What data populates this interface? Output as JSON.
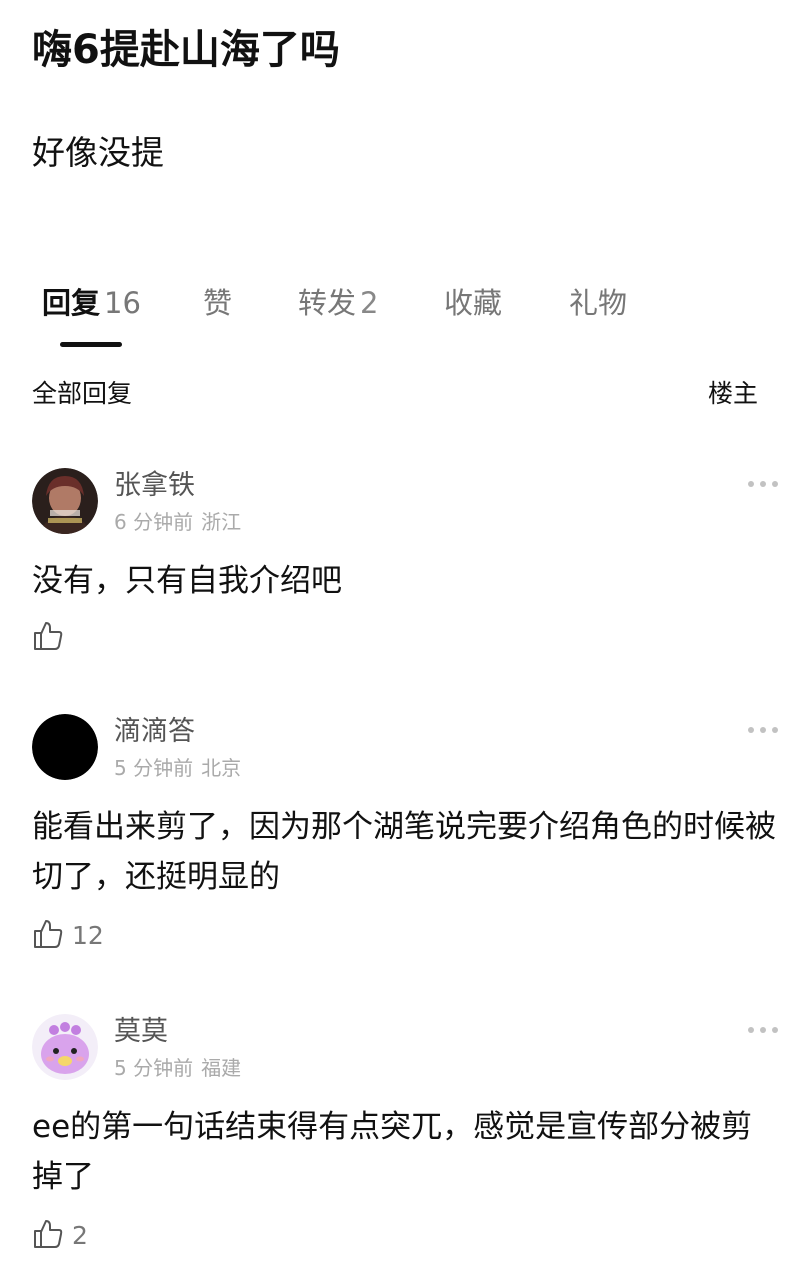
{
  "post": {
    "title": "嗨6提赴山海了吗",
    "body": "好像没提"
  },
  "tabs": [
    {
      "label": "回复",
      "count": "16",
      "active": true
    },
    {
      "label": "赞",
      "count": "",
      "active": false
    },
    {
      "label": "转发",
      "count": "2",
      "active": false
    },
    {
      "label": "收藏",
      "count": "",
      "active": false
    },
    {
      "label": "礼物",
      "count": "",
      "active": false
    }
  ],
  "reply_header": {
    "all_label": "全部回复",
    "op_label": "楼主"
  },
  "comments": [
    {
      "username": "张拿铁",
      "time": "6 分钟前",
      "location": "浙江",
      "text": "没有，只有自我介绍吧",
      "likes": "",
      "avatar_icon": "photo-avatar-icon"
    },
    {
      "username": "滴滴答",
      "time": "5 分钟前",
      "location": "北京",
      "text": "能看出来剪了，因为那个湖笔说完要介绍角色的时候被切了，还挺明显的",
      "likes": "12",
      "avatar_icon": "black-circle-avatar-icon"
    },
    {
      "username": "莫莫",
      "time": "5 分钟前",
      "location": "福建",
      "text": "ee的第一句话结束得有点突兀，感觉是宣传部分被剪掉了",
      "likes": "2",
      "avatar_icon": "purple-cartoon-avatar-icon"
    }
  ],
  "icons": {
    "like": "thumbs-up-icon",
    "more": "more-dots-icon"
  },
  "colors": {
    "text_primary": "#111111",
    "text_secondary": "#777777",
    "meta": "#aaaaaa"
  }
}
